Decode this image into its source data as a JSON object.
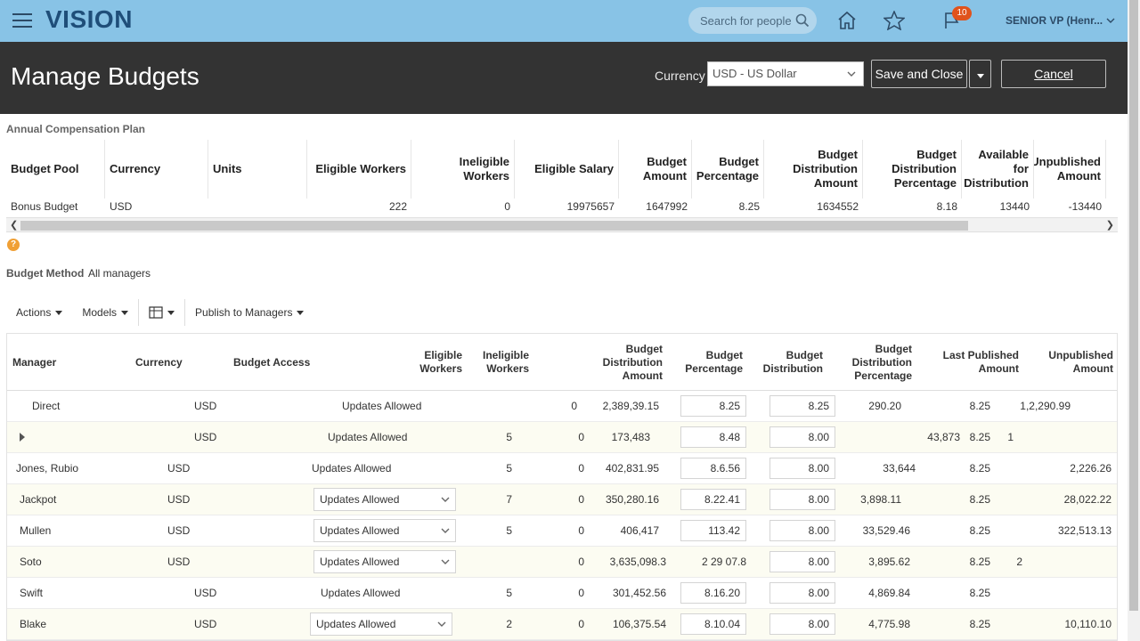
{
  "app": {
    "logo": "VISION",
    "search_placeholder": "Search for people",
    "notifications_count": "10",
    "user": "SENIOR VP (Henr..."
  },
  "header": {
    "title": "Manage Budgets",
    "currency_label": "Currency",
    "currency_value": "USD - US Dollar",
    "save_close": "Save and Close",
    "cancel": "Cancel"
  },
  "plan": {
    "label": "Annual Compensation Plan",
    "columns": [
      "Budget Pool",
      "Currency",
      "Units",
      "Eligible Workers",
      "Ineligible Workers",
      "Eligible Salary",
      "Budget Amount",
      "Budget Percentage",
      "Budget Distribution Amount",
      "Budget Distribution Percentage",
      "Available for Distribution",
      "Unpublished Amount"
    ],
    "row": [
      "Bonus Budget",
      "USD",
      "",
      "222",
      "0",
      "19975657",
      "1647992",
      "8.25",
      "1634552",
      "8.18",
      "13440",
      "-13440"
    ]
  },
  "method": {
    "label": "Budget Method",
    "value": "All managers"
  },
  "toolbar": {
    "actions": "Actions",
    "models": "Models",
    "publish": "Publish to Managers"
  },
  "managers": {
    "columns": [
      "Manager",
      "Currency",
      "Budget Access",
      "Eligible Workers",
      "Ineligible Workers",
      "Budget Distribution Amount",
      "Budget Percentage",
      "Budget Distribution",
      "Budget Distribution Percentage",
      "Last Published Amount",
      "Unpublished Amount"
    ],
    "rows": [
      {
        "name": "Direct",
        "currency": "USD",
        "access": "Updates Allowed",
        "eligible": "",
        "ineligible": "0",
        "amount": "2,389,39.15",
        "pct": "8.25",
        "dist_pct": "8.25",
        "dist": "290.20",
        "dp2": "8.25",
        "last": "1,2,290.99"
      },
      {
        "name": "",
        "currency": "USD",
        "access": "Updates Allowed",
        "eligible": "5",
        "ineligible": "0",
        "amount": "173,483",
        "pct": "8.48",
        "dist_pct": "8.00",
        "dist": "43,873",
        "dp2": "8.25",
        "last": "1"
      },
      {
        "name": "Jones, Rubio",
        "currency": "USD",
        "access": "Updates Allowed",
        "eligible": "5",
        "ineligible": "0",
        "amount": "402,831.95",
        "pct": "8.6.56",
        "dist_pct": "8.00",
        "dist": "33,644",
        "dp2": "8.25",
        "last": "2,226.26"
      },
      {
        "name": "Jackpot",
        "currency": "USD",
        "access": "Updates Allowed",
        "eligible": "7",
        "ineligible": "0",
        "amount": "350,280.16",
        "pct": "8.22.41",
        "dist_pct": "8.00",
        "dist": "3,898.11",
        "dp2": "8.25",
        "last": "28,022.22"
      },
      {
        "name": "Mullen",
        "currency": "USD",
        "access": "Updates Allowed",
        "eligible": "5",
        "ineligible": "0",
        "amount": "406,417",
        "pct": "113.42",
        "dist_pct": "8.00",
        "dist": "33,529.46",
        "dp2": "8.25",
        "last": "322,513.13"
      },
      {
        "name": "Soto",
        "currency": "USD",
        "access": "Updates Allowed",
        "eligible": "",
        "ineligible": "0",
        "amount": "3,635,098.3",
        "pct": "2 29 07.8",
        "dist_pct": "8.00",
        "dist": "3,895.62",
        "dp2": "8.25",
        "last": "2"
      },
      {
        "name": "Swift",
        "currency": "USD",
        "access": "Updates Allowed",
        "eligible": "5",
        "ineligible": "0",
        "amount": "301,452.56",
        "pct": "8.16.20",
        "dist_pct": "8.00",
        "dist": "4,869.84",
        "dp2": "8.25",
        "last": ""
      },
      {
        "name": "Blake",
        "currency": "USD",
        "access": "Updates Allowed",
        "eligible": "2",
        "ineligible": "0",
        "amount": "106,375.54",
        "pct": "8.10.04",
        "dist_pct": "8.00",
        "dist": "4,775.98",
        "dp2": "8.25",
        "last": "10,110.10"
      }
    ]
  },
  "colors": {
    "topbar": "#88c3e6",
    "titlebar": "#333333",
    "badge": "#e0531c",
    "help": "#f0a035"
  }
}
